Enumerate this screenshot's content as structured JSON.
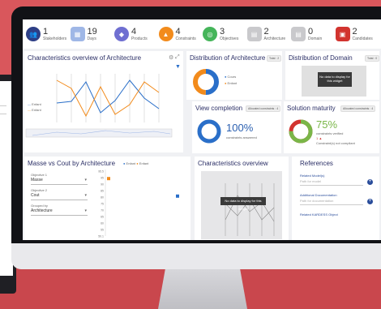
{
  "kpis": [
    {
      "value": "1",
      "label": "Stakeholders",
      "icon": "people-icon",
      "color": "#2e3f86",
      "glyph": "👥"
    },
    {
      "value": "19",
      "label": "Days",
      "icon": "calendar-icon",
      "color": "#9fb7e6",
      "glyph": "▦"
    },
    {
      "value": "4",
      "label": "Products",
      "icon": "product-icon",
      "color": "#6f6fd1",
      "glyph": "◆"
    },
    {
      "value": "4",
      "label": "Constraints",
      "icon": "warning-icon",
      "color": "#f28b1c",
      "glyph": "▲"
    },
    {
      "value": "3",
      "label": "Objectives",
      "icon": "target-icon",
      "color": "#45b55a",
      "glyph": "◎"
    },
    {
      "value": "2",
      "label": "Architecture",
      "icon": "architecture-icon",
      "color": "#c9c9cc",
      "glyph": "▤"
    },
    {
      "value": "0",
      "label": "Domain",
      "icon": "domain-icon",
      "color": "#c9c9cc",
      "glyph": "▤"
    },
    {
      "value": "2",
      "label": "Candidates",
      "icon": "candidates-icon",
      "color": "#d2342f",
      "glyph": "▣"
    }
  ],
  "panels": {
    "char_arch": {
      "title": "Characteristics overview of Architecture",
      "legend": [
        "Enfant",
        "Enfant"
      ]
    },
    "dist_arch": {
      "title": "Distribution of Architecture",
      "chip": "Total : 2",
      "legend": [
        "Cours",
        "Enfant"
      ]
    },
    "dist_domain": {
      "title": "Distribution of Domain",
      "chip": "Total : 0",
      "empty_text": "No data to display for this widget"
    },
    "view_completion": {
      "title": "View completion",
      "chip": "Allocated constraints : 4",
      "percent": "100%",
      "sub": "constraints answered",
      "value": 1.0
    },
    "solution_maturity": {
      "title": "Solution maturity",
      "chip": "Allocated constraints : 4",
      "percent": "75%",
      "sub1": "constraints verified",
      "sub2": "1 ▲",
      "sub3": "Constraint(s) not compliant",
      "value": 0.75
    },
    "masse_cout": {
      "title": "Masse vs Cout by Architecture",
      "obj1_label": "Objective 1",
      "obj1_value": "Masse",
      "obj2_label": "Objective 2",
      "obj2_value": "Cout",
      "group_label": "Grouped by",
      "group_value": "Architecture",
      "legend": [
        "Enfant",
        "Enfant"
      ]
    },
    "char_overview": {
      "title": "Characteristics overview",
      "empty_text": "No data to display for this widget"
    },
    "references": {
      "title": "References",
      "models_label": "Related Model(s)",
      "models_placeholder": "Path for model",
      "docs_label": "Additional Documentation",
      "docs_placeholder": "Path for documentation",
      "next_label": "Related KARDESS Object"
    }
  },
  "chart_data": {
    "type": "scatter",
    "title": "Masse vs Cout by Architecture",
    "xlabel": "",
    "ylabel": "",
    "series": [
      {
        "name": "Enfant",
        "color": "#2a6fc9",
        "points": [
          [
            89,
            41
          ]
        ]
      },
      {
        "name": "Enfant",
        "color": "#f28b1c",
        "points": [
          [
            4,
            59
          ]
        ]
      }
    ],
    "yticks": [
      "95.5",
      "95",
      "90",
      "85",
      "80",
      "75",
      "70",
      "65",
      "60",
      "55",
      "50.1"
    ]
  }
}
